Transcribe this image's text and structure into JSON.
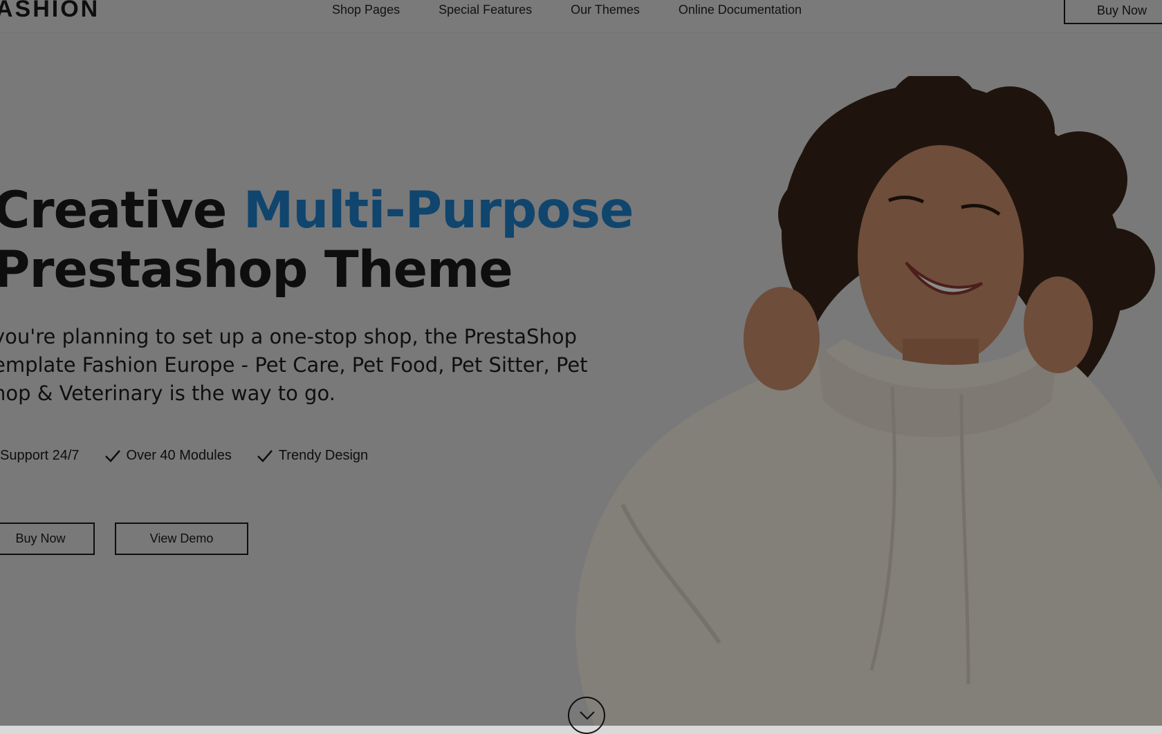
{
  "header": {
    "logo": "ASHION",
    "nav": [
      "Shop Pages",
      "Special Features",
      "Our Themes",
      "Online Documentation"
    ],
    "buy_label": "Buy Now"
  },
  "hero": {
    "title_part1": "Creative ",
    "title_accent": "Multi-Purpose",
    "title_line2": "Prestashop Theme",
    "desc_line1": "you're planning to set up a one-stop shop, the PrestaShop",
    "desc_line2": "emplate Fashion Europe - Pet Care, Pet Food, Pet Sitter, Pet",
    "desc_line3": "hop & Veterinary is the way to go.",
    "features": [
      "Support 24/7",
      "Over 40 Modules",
      "Trendy Design"
    ],
    "buy_label": "Buy Now",
    "demo_label": "View Demo"
  },
  "colors": {
    "accent": "#1e7fc8",
    "overlay": "rgba(0,0,0,0.45)"
  }
}
